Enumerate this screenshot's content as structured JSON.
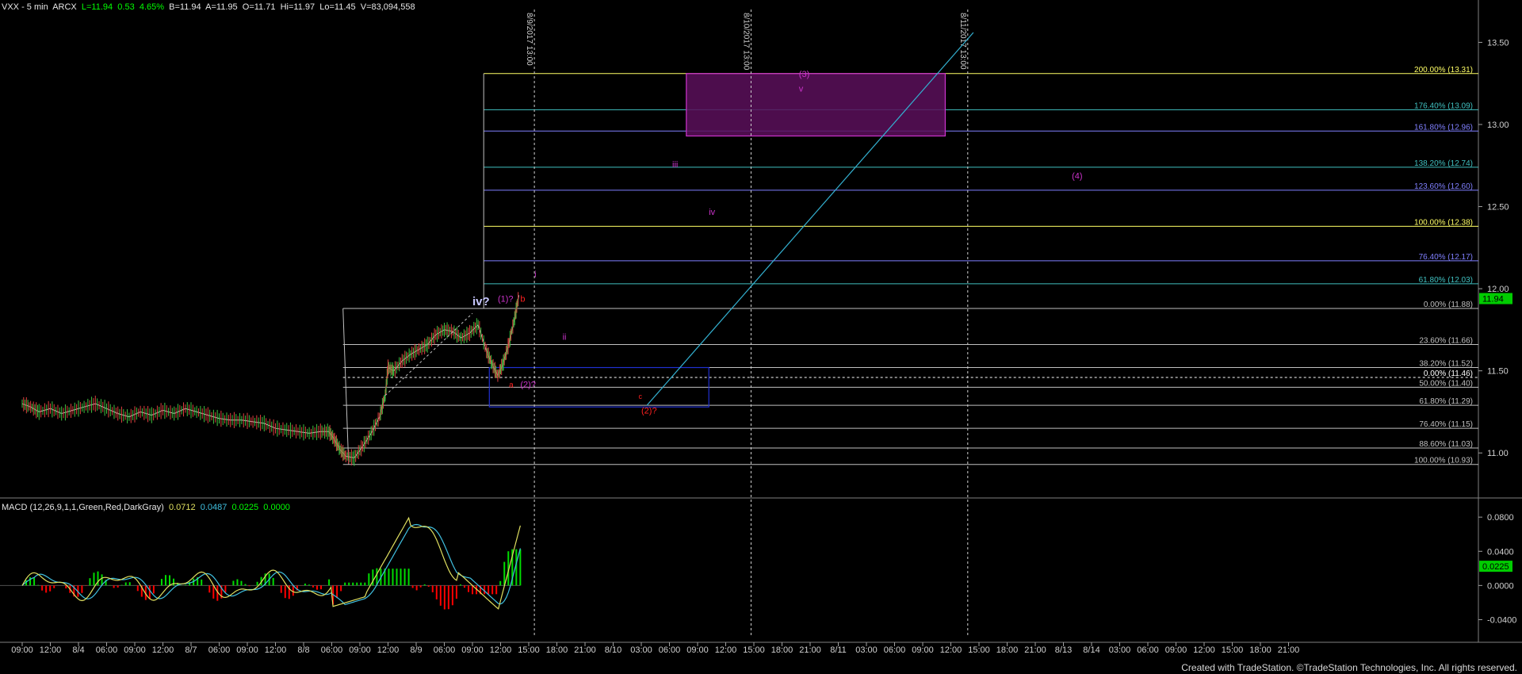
{
  "header": {
    "symbol": "VXX - 5 min  ARCX",
    "last": "L=11.94",
    "change": "0.53",
    "change_pct": "4.65%",
    "bid": "B=11.94",
    "ask": "A=11.95",
    "open": "O=11.71",
    "high": "Hi=11.97",
    "low": "Lo=11.45",
    "volume": "V=83,094,558"
  },
  "macd_header": {
    "label": "MACD (12,26,9,1,1,Green,Red,DarkGray)",
    "v1": "0.0712",
    "v2": "0.0487",
    "v3": "0.0225",
    "v4": "0.0000"
  },
  "footer": "Created with TradeStation. ©TradeStation Technologies, Inc. All rights reserved.",
  "colors": {
    "background": "#000000",
    "price_line": "#c8c8c8",
    "fib_yellow": "#ffff66",
    "fib_blue": "#8080ff",
    "fib_teal": "#40c0c0",
    "fib_gray": "#c0c0c0",
    "magenta": "#cc33cc",
    "red": "#ff2020",
    "diag_line": "#33b0d0",
    "macd_green": "#00dd00",
    "macd_red": "#ff0000",
    "macd_line1": "#e0e060",
    "macd_line2": "#40c0e0"
  },
  "chart_data": {
    "type": "line",
    "title": "VXX - 5 min",
    "ylim": [
      10.75,
      13.7
    ],
    "yticks": [
      "13.50",
      "13.00",
      "12.50",
      "12.00",
      "11.50",
      "11.00"
    ],
    "ytick_values": [
      13.5,
      13.0,
      12.5,
      12.0,
      11.5,
      11.0
    ],
    "last_price_label": "11.94",
    "last_price": 11.94,
    "xtick_labels": [
      "09:00",
      "12:00",
      "8/4",
      "06:00",
      "09:00",
      "12:00",
      "8/7",
      "06:00",
      "09:00",
      "12:00",
      "8/8",
      "06:00",
      "09:00",
      "12:00",
      "8/9",
      "06:00",
      "09:00",
      "12:00",
      "15:00",
      "18:00",
      "21:00",
      "8/10",
      "03:00",
      "06:00",
      "09:00",
      "12:00",
      "15:00",
      "18:00",
      "21:00",
      "8/11",
      "03:00",
      "06:00",
      "09:00",
      "12:00",
      "15:00",
      "18:00",
      "21:00",
      "8/13",
      "8/14",
      "03:00",
      "06:00",
      "09:00",
      "12:00",
      "15:00",
      "18:00",
      "21:00"
    ],
    "xtick_index": [
      0,
      1,
      2,
      3,
      4,
      5,
      6,
      7,
      8,
      9,
      10,
      11,
      12,
      13,
      14,
      15,
      16,
      17,
      18,
      19,
      20,
      21,
      22,
      23,
      24,
      25,
      26,
      27,
      28,
      29,
      30,
      31,
      32,
      33,
      34,
      35,
      36,
      37,
      38,
      39,
      40,
      41,
      42,
      43,
      44,
      45
    ],
    "price_series": {
      "name": "VXX",
      "points": [
        [
          0,
          11.3
        ],
        [
          0.3,
          11.28
        ],
        [
          0.6,
          11.25
        ],
        [
          1.0,
          11.27
        ],
        [
          1.4,
          11.24
        ],
        [
          1.8,
          11.26
        ],
        [
          2.2,
          11.28
        ],
        [
          2.6,
          11.3
        ],
        [
          3.0,
          11.27
        ],
        [
          3.4,
          11.24
        ],
        [
          3.8,
          11.22
        ],
        [
          4.2,
          11.25
        ],
        [
          4.6,
          11.23
        ],
        [
          5.0,
          11.26
        ],
        [
          5.4,
          11.24
        ],
        [
          5.8,
          11.27
        ],
        [
          6.2,
          11.25
        ],
        [
          6.6,
          11.23
        ],
        [
          7.0,
          11.21
        ],
        [
          7.4,
          11.2
        ],
        [
          7.8,
          11.2
        ],
        [
          8.2,
          11.19
        ],
        [
          8.6,
          11.18
        ],
        [
          9.0,
          11.15
        ],
        [
          9.4,
          11.14
        ],
        [
          9.8,
          11.13
        ],
        [
          10.2,
          11.12
        ],
        [
          10.6,
          11.13
        ],
        [
          10.9,
          11.13
        ],
        [
          11.1,
          11.08
        ],
        [
          11.3,
          11.02
        ],
        [
          11.5,
          10.98
        ],
        [
          11.8,
          10.97
        ],
        [
          12.1,
          11.04
        ],
        [
          12.4,
          11.12
        ],
        [
          12.7,
          11.22
        ],
        [
          12.9,
          11.35
        ],
        [
          13.0,
          11.52
        ],
        [
          13.2,
          11.5
        ],
        [
          13.5,
          11.56
        ],
        [
          13.8,
          11.6
        ],
        [
          14.1,
          11.63
        ],
        [
          14.4,
          11.66
        ],
        [
          14.7,
          11.72
        ],
        [
          15.0,
          11.75
        ],
        [
          15.3,
          11.74
        ],
        [
          15.6,
          11.7
        ],
        [
          15.9,
          11.73
        ],
        [
          16.2,
          11.78
        ],
        [
          16.5,
          11.62
        ],
        [
          16.7,
          11.54
        ],
        [
          16.9,
          11.47
        ],
        [
          17.1,
          11.55
        ],
        [
          17.3,
          11.67
        ],
        [
          17.5,
          11.82
        ],
        [
          17.65,
          11.96
        ]
      ]
    },
    "fib_levels": [
      {
        "label": "200.00% (13.31)",
        "value": 13.31,
        "color": "#ffff66"
      },
      {
        "label": "176.40% (13.09)",
        "value": 13.09,
        "color": "#40c0c0"
      },
      {
        "label": "161.80% (12.96)",
        "value": 12.96,
        "color": "#8080ff"
      },
      {
        "label": "138.20% (12.74)",
        "value": 12.74,
        "color": "#40c0c0"
      },
      {
        "label": "123.60% (12.60)",
        "value": 12.6,
        "color": "#8080ff"
      },
      {
        "label": "100.00% (12.38)",
        "value": 12.38,
        "color": "#ffff66"
      },
      {
        "label": "76.40% (12.17)",
        "value": 12.17,
        "color": "#8080ff"
      },
      {
        "label": "61.80% (12.03)",
        "value": 12.03,
        "color": "#40c0c0"
      },
      {
        "label": "0.00% (11.88)",
        "value": 11.88,
        "color": "#c0c0c0"
      },
      {
        "label": "23.60% (11.66)",
        "value": 11.66,
        "color": "#c0c0c0"
      },
      {
        "label": "38.20% (11.52)",
        "value": 11.52,
        "color": "#c0c0c0"
      },
      {
        "label": "0.00% (11.46)",
        "value": 11.46,
        "color": "#ffffff"
      },
      {
        "label": "50.00% (11.40)",
        "value": 11.4,
        "color": "#c0c0c0"
      },
      {
        "label": "61.80% (11.29)",
        "value": 11.29,
        "color": "#c0c0c0"
      },
      {
        "label": "76.40% (11.15)",
        "value": 11.15,
        "color": "#c0c0c0"
      },
      {
        "label": "88.60% (11.03)",
        "value": 11.03,
        "color": "#c0c0c0"
      },
      {
        "label": "100.00% (10.93)",
        "value": 10.93,
        "color": "#c0c0c0"
      }
    ],
    "vlines": [
      {
        "label": "8/9/2017 13:00",
        "x": 18.2
      },
      {
        "label": "8/10/2017 13:00",
        "x": 25.9
      },
      {
        "label": "8/11/2017 13:00",
        "x": 33.6
      }
    ],
    "boxes": [
      {
        "name": "magenta-target-box",
        "x0": 23.6,
        "x1": 32.8,
        "y0": 12.93,
        "y1": 13.31,
        "color": "#cc33cc"
      },
      {
        "name": "blue-support-box",
        "x0": 16.6,
        "x1": 24.4,
        "y0": 11.28,
        "y1": 11.52,
        "color": "#2030d0"
      }
    ],
    "wave_labels": [
      {
        "text": "iv?",
        "x": 16.0,
        "y": 11.9,
        "color": "#c8c8ff",
        "size": 15
      },
      {
        "text": "(1)?",
        "x": 16.9,
        "y": 11.92,
        "color": "#cc33cc",
        "size": 11
      },
      {
        "text": "b",
        "x": 17.7,
        "y": 11.92,
        "color": "#ff2020",
        "size": 11
      },
      {
        "text": "i",
        "x": 18.2,
        "y": 12.07,
        "color": "#cc33cc",
        "size": 11
      },
      {
        "text": "ii",
        "x": 19.2,
        "y": 11.69,
        "color": "#cc33cc",
        "size": 11
      },
      {
        "text": "a",
        "x": 17.3,
        "y": 11.4,
        "color": "#ff2020",
        "size": 10
      },
      {
        "text": "(2)?",
        "x": 17.7,
        "y": 11.4,
        "color": "#cc33cc",
        "size": 11
      },
      {
        "text": "c",
        "x": 21.9,
        "y": 11.33,
        "color": "#ff2020",
        "size": 9
      },
      {
        "text": "(2)?",
        "x": 22.0,
        "y": 11.24,
        "color": "#ff2020",
        "size": 11
      },
      {
        "text": "iii",
        "x": 23.1,
        "y": 12.74,
        "color": "#cc33cc",
        "size": 11
      },
      {
        "text": "iv",
        "x": 24.4,
        "y": 12.45,
        "color": "#cc33cc",
        "size": 11
      },
      {
        "text": "(3)",
        "x": 27.6,
        "y": 13.29,
        "color": "#cc33cc",
        "size": 11
      },
      {
        "text": "v",
        "x": 27.6,
        "y": 13.2,
        "color": "#cc33cc",
        "size": 11
      },
      {
        "text": "(4)",
        "x": 37.3,
        "y": 12.67,
        "color": "#cc33cc",
        "size": 11
      }
    ],
    "diag_line": {
      "x0": 22.2,
      "y0": 11.29,
      "x1": 33.8,
      "y1": 13.56
    }
  },
  "macd_data": {
    "ylim": [
      -0.06,
      0.095
    ],
    "yticks": [
      "0.0800",
      "0.0400",
      "0.0000",
      "-0.0400"
    ],
    "ytick_values": [
      0.08,
      0.04,
      0.0,
      -0.04
    ],
    "last_label": "0.0225",
    "last_value": 0.0225
  }
}
